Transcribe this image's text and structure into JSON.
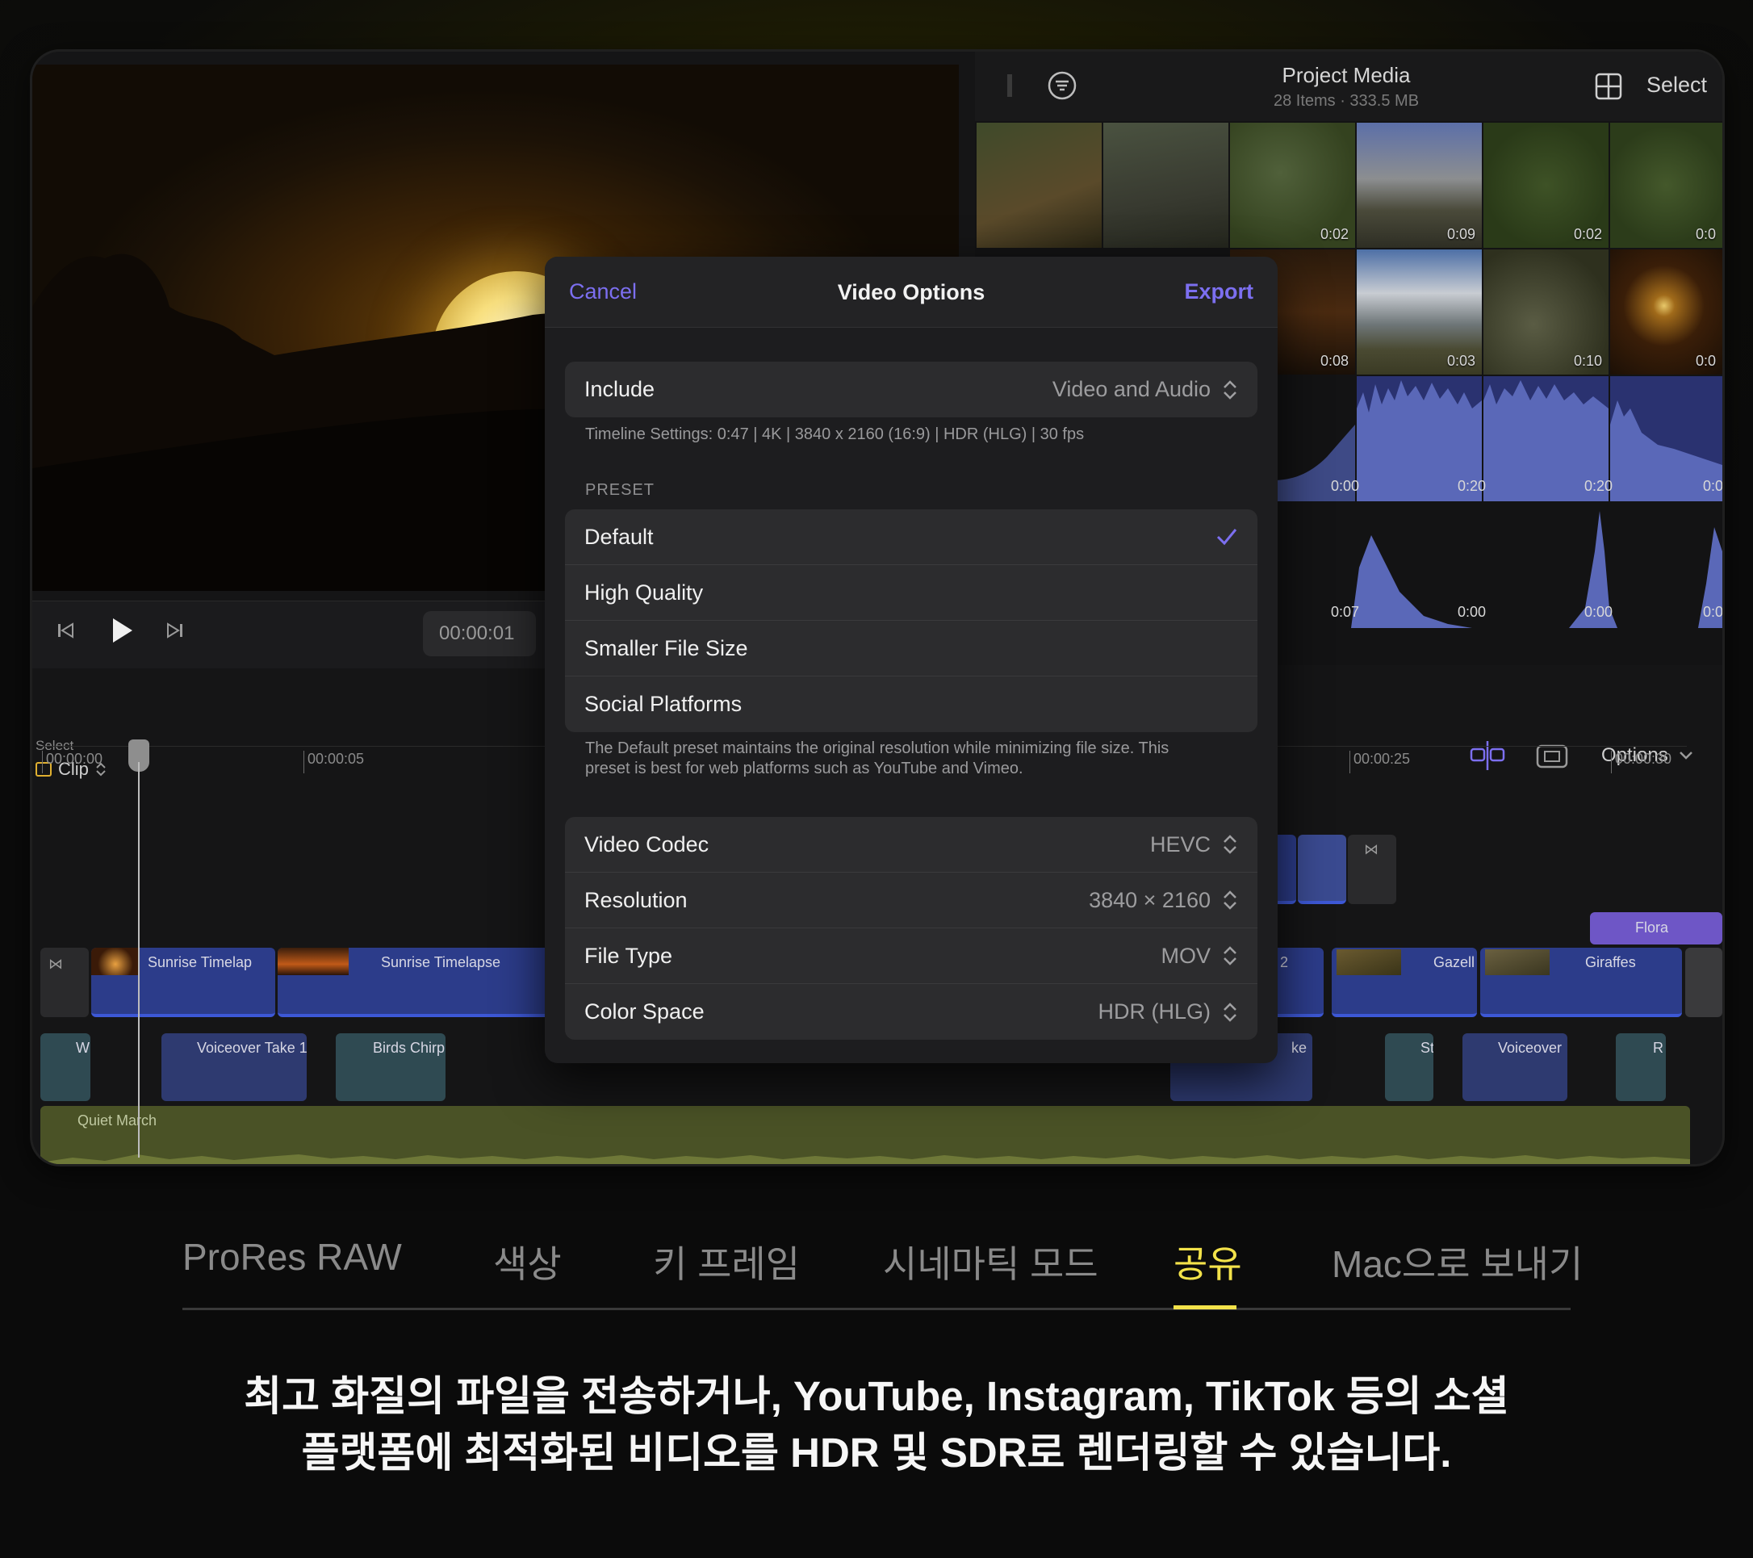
{
  "viewer": {
    "timecode": "00:00:01"
  },
  "browser": {
    "title": "Project Media",
    "subtitle": "28 Items  ·  333.5 MB",
    "select_label": "Select",
    "durations": [
      "0:02",
      "0:09",
      "0:02",
      "0:0",
      "0:08",
      "0:03",
      "0:10",
      "0:0",
      "0:00",
      "0:20",
      "0:20",
      "0:0",
      "0:07",
      "0:00",
      "0:00",
      "0:0"
    ]
  },
  "timeline": {
    "select_label": "Select",
    "mode_label": "Clip",
    "options_label": "Options",
    "ruler": [
      "00:00:00",
      "00:00:05",
      "00:00:25",
      "00:00:30"
    ],
    "clips": {
      "sunrise1": "Sunrise Timelap",
      "sunrise2": "Sunrise Timelapse",
      "zebras": "bras 2",
      "gazelle": "Gazell",
      "giraffes": "Giraffes",
      "flora": "Flora",
      "voiceover1": "Voiceover Take 1",
      "birds": "Birds Chirp",
      "w": "W",
      "ke": "ke",
      "st": "St",
      "voiceover2": "Voiceover",
      "r": "R",
      "music": "Quiet March"
    }
  },
  "dialog": {
    "cancel": "Cancel",
    "title": "Video Options",
    "export": "Export",
    "include_label": "Include",
    "include_value": "Video and Audio",
    "timeline_settings": "Timeline Settings: 0:47 | 4K | 3840 x 2160 (16:9) | HDR (HLG) | 30 fps",
    "preset_header": "PRESET",
    "presets": [
      "Default",
      "High Quality",
      "Smaller File Size",
      "Social Platforms"
    ],
    "preset_note_1": "The Default preset maintains the original resolution while minimizing file size. This",
    "preset_note_2": "preset is best for web platforms such as YouTube and Vimeo.",
    "settings": [
      {
        "label": "Video Codec",
        "value": "HEVC"
      },
      {
        "label": "Resolution",
        "value": "3840 × 2160"
      },
      {
        "label": "File Type",
        "value": "MOV"
      },
      {
        "label": "Color Space",
        "value": "HDR (HLG)"
      }
    ],
    "accent": "#7c6ff0"
  },
  "tabs": [
    "ProRes RAW",
    "색상",
    "키 프레임",
    "시네마틱 모드",
    "공유",
    "Mac으로 보내기"
  ],
  "active_tab": "공유",
  "caption": {
    "line1": "최고 화질의 파일을 전송하거나, YouTube, Instagram, TikTok 등의 소셜",
    "line2": "플랫폼에 최적화된 비디오를 HDR 및 SDR로 렌더링할 수 있습니다."
  },
  "colors": {
    "highlight": "#f3e24a",
    "accent": "#7c6ff0"
  }
}
